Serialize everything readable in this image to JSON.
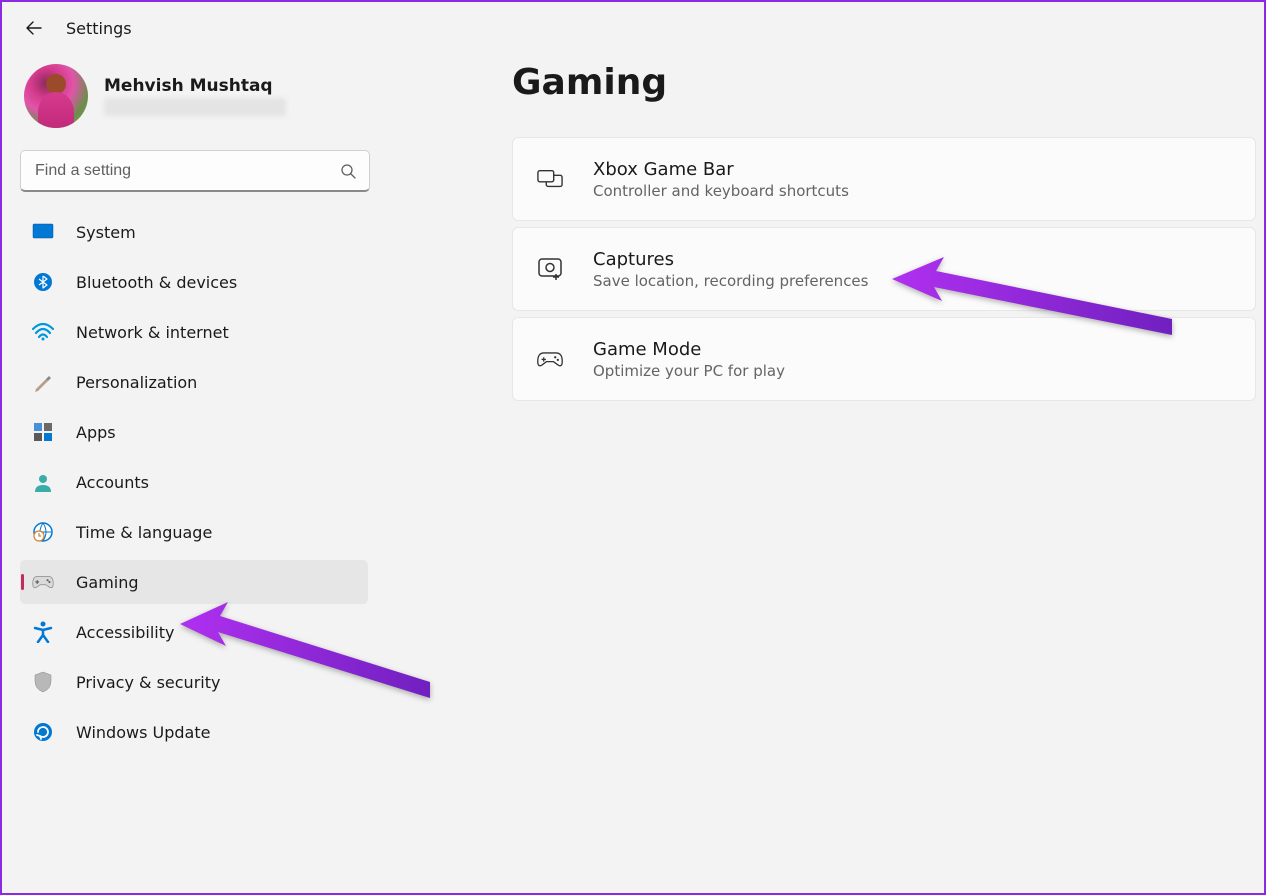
{
  "header": {
    "app_title": "Settings"
  },
  "profile": {
    "name": "Mehvish Mushtaq"
  },
  "search": {
    "placeholder": "Find a setting"
  },
  "nav": {
    "items": [
      {
        "label": "System"
      },
      {
        "label": "Bluetooth & devices"
      },
      {
        "label": "Network & internet"
      },
      {
        "label": "Personalization"
      },
      {
        "label": "Apps"
      },
      {
        "label": "Accounts"
      },
      {
        "label": "Time & language"
      },
      {
        "label": "Gaming"
      },
      {
        "label": "Accessibility"
      },
      {
        "label": "Privacy & security"
      },
      {
        "label": "Windows Update"
      }
    ],
    "selected_index": 7
  },
  "page": {
    "title": "Gaming",
    "cards": [
      {
        "title": "Xbox Game Bar",
        "subtitle": "Controller and keyboard shortcuts"
      },
      {
        "title": "Captures",
        "subtitle": "Save location, recording preferences"
      },
      {
        "title": "Game Mode",
        "subtitle": "Optimize your PC for play"
      }
    ]
  }
}
